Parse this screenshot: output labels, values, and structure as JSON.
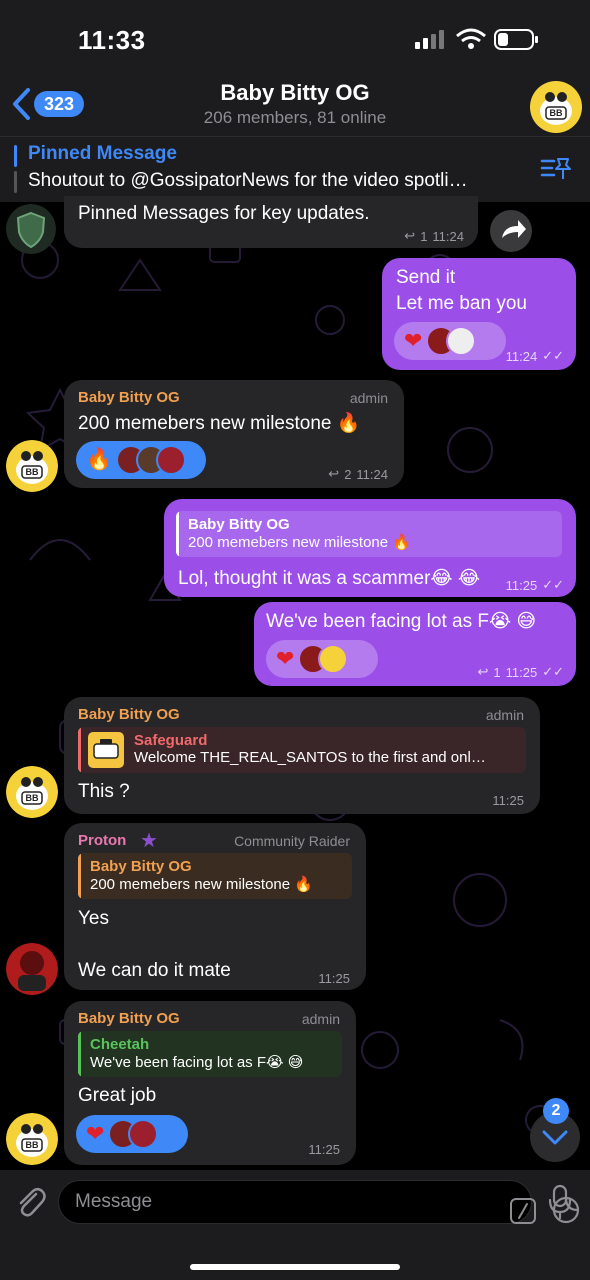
{
  "status_bar": {
    "time": "11:33"
  },
  "header": {
    "back_count": "323",
    "title": "Baby Bitty OG",
    "subtitle": "206 members, 81 online"
  },
  "pinned": {
    "title": "Pinned Message",
    "text": "Shoutout to @GossipatorNews for the video spotli…"
  },
  "colors": {
    "accent": "#3e88f7",
    "outgoing_bubble": "#9b4ee8",
    "incoming_bubble": "#262628",
    "sender_orange": "#f0a050",
    "proton_pink": "#e87ab0",
    "cheetah_green": "#59c35b",
    "safeguard_red": "#ef6b6b"
  },
  "messages": [
    {
      "text": "Pinned Messages for key updates.",
      "replies": "1",
      "time": "11:24"
    },
    {
      "line1": "Send it",
      "line2": "Let me ban you",
      "time": "11:24"
    },
    {
      "sender": "Baby Bitty OG",
      "role": "admin",
      "text": "200 memebers new milestone 🔥",
      "reaction": "🔥",
      "replies": "2",
      "time": "11:24"
    },
    {
      "reply_name": "Baby Bitty OG",
      "reply_text": "200 memebers new milestone 🔥",
      "text": "Lol, thought it was a scammer😂 😂",
      "time": "11:25"
    },
    {
      "text": "We've been facing lot as F😭 😅",
      "replies": "1",
      "time": "11:25"
    },
    {
      "sender": "Baby Bitty OG",
      "role": "admin",
      "reply_name": "Safeguard",
      "reply_text": "Welcome THE_REAL_SANTOS to the first and onl…",
      "text": "This ?",
      "time": "11:25"
    },
    {
      "sender": "Proton",
      "role": "Community Raider",
      "reply_name": "Baby Bitty OG",
      "reply_text": "200 memebers new milestone 🔥",
      "line1": "Yes",
      "line2": "We can do it mate",
      "time": "11:25"
    },
    {
      "sender": "Baby Bitty OG",
      "role": "admin",
      "reply_name": "Cheetah",
      "reply_text": "We've been facing lot as F😭 😅",
      "text": "Great job",
      "time": "11:25"
    }
  ],
  "scroll_badge": "2",
  "input": {
    "placeholder": "Message"
  }
}
